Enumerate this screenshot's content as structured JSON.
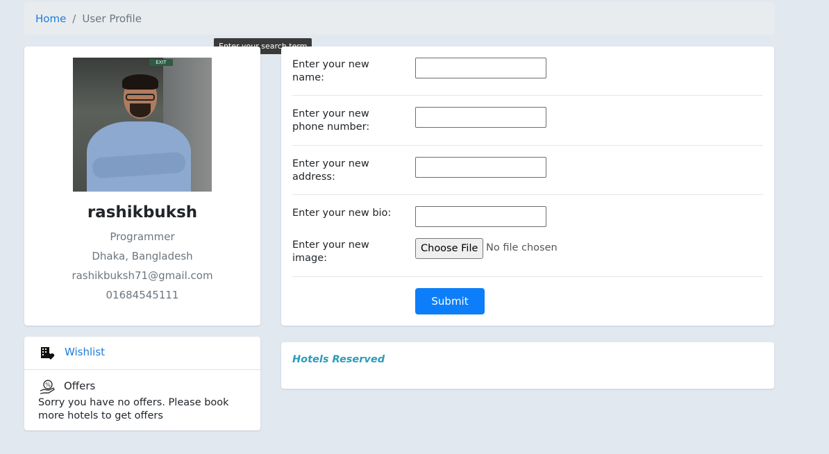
{
  "breadcrumb": {
    "home": "Home",
    "separator": "/",
    "current": "User Profile"
  },
  "tooltip": "Enter your search term",
  "profile": {
    "username": "rashikbuksh",
    "role": "Programmer",
    "location": "Dhaka, Bangladesh",
    "email": "rashikbuksh71@gmail.com",
    "phone": "01684545111",
    "photo_sign_text": "EXIT"
  },
  "form": {
    "name_label": "Enter your new name:",
    "phone_label": "Enter your new phone number:",
    "address_label": "Enter your new address:",
    "bio_label": "Enter your new bio:",
    "image_label": "Enter your new image:",
    "choose_file": "Choose File",
    "file_status": "No file chosen",
    "submit": "Submit"
  },
  "sidebar": {
    "wishlist": "Wishlist",
    "offers": "Offers",
    "offers_message": "Sorry you have no offers. Please book more hotels to get offers"
  },
  "hotels": {
    "title": "Hotels Reserved"
  },
  "colors": {
    "link": "#1e7bd8",
    "primary": "#0d7ef9",
    "accent": "#2a9bbb",
    "background": "#e2e8f0"
  }
}
